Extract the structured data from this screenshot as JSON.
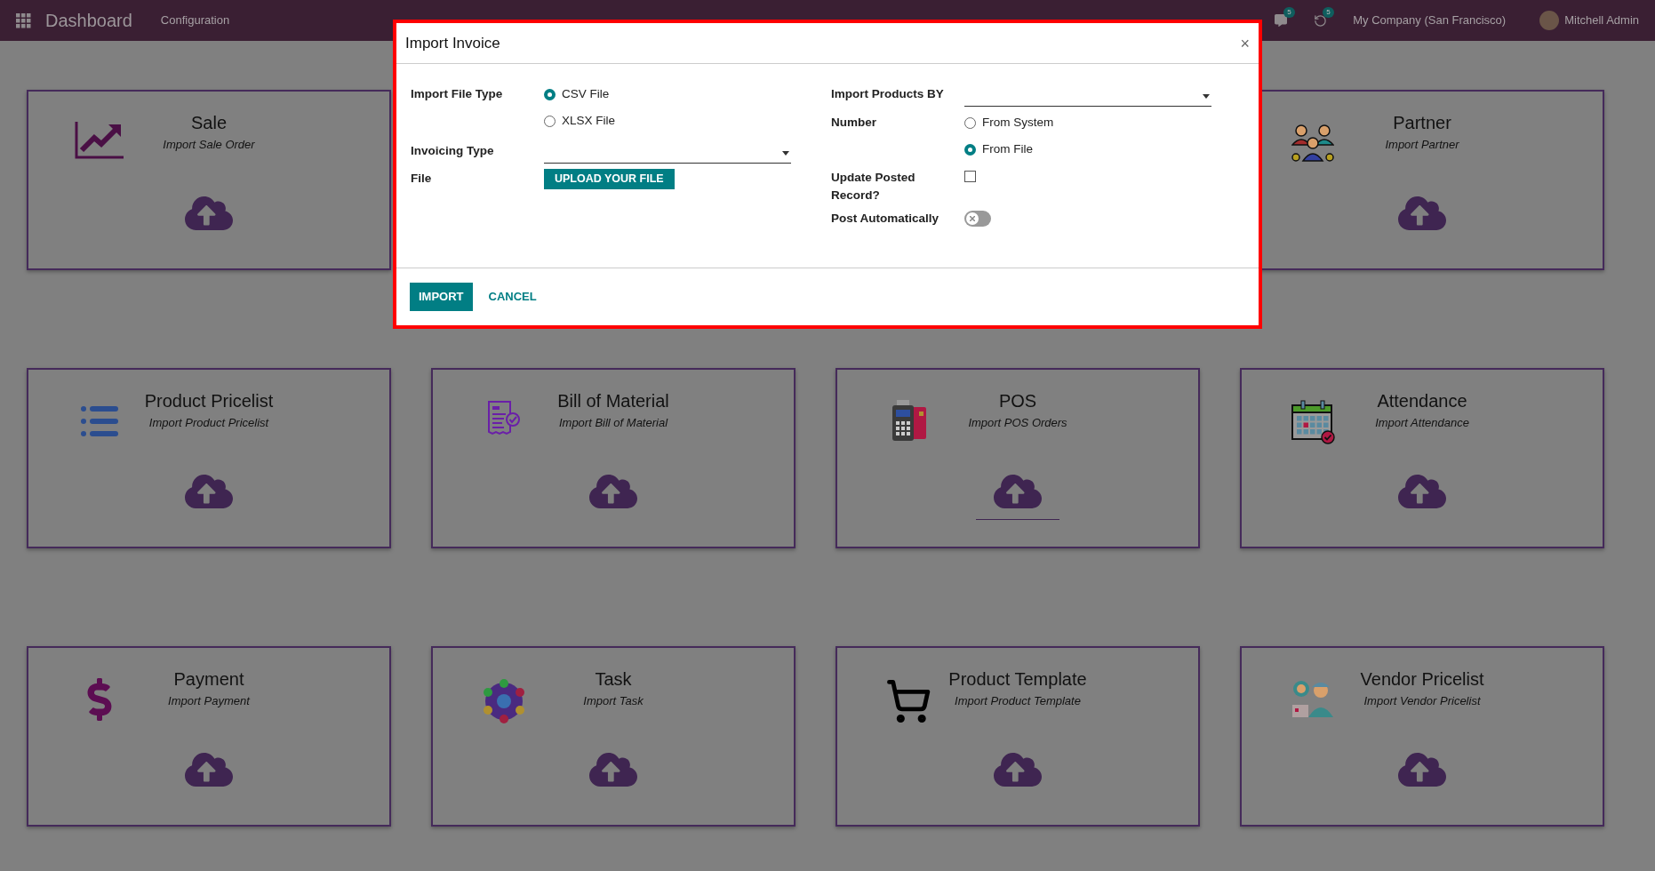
{
  "navbar": {
    "app_title": "Dashboard",
    "menu": [
      {
        "label": "Configuration"
      }
    ],
    "messages_badge": "5",
    "activities_badge": "5",
    "company": "My Company (San Francisco)",
    "user": "Mitchell Admin"
  },
  "cards": [
    {
      "title": "Sale",
      "subtitle": "Import Sale Order",
      "focused": false
    },
    {
      "title": "Partner",
      "subtitle": "Import Partner",
      "focused": false
    },
    {
      "title": "Product Pricelist",
      "subtitle": "Import Product Pricelist",
      "focused": false
    },
    {
      "title": "Bill of Material",
      "subtitle": "Import Bill of Material",
      "focused": false
    },
    {
      "title": "POS",
      "subtitle": "Import POS Orders",
      "focused": true
    },
    {
      "title": "Attendance",
      "subtitle": "Import Attendance",
      "focused": false
    },
    {
      "title": "Payment",
      "subtitle": "Import Payment",
      "focused": false
    },
    {
      "title": "Task",
      "subtitle": "Import Task",
      "focused": false
    },
    {
      "title": "Product Template",
      "subtitle": "Import Product Template",
      "focused": false
    },
    {
      "title": "Vendor Pricelist",
      "subtitle": "Import Vendor Pricelist",
      "focused": false
    }
  ],
  "dialog": {
    "title": "Import Invoice",
    "close": "×",
    "import_file_type": {
      "label": "Import File Type",
      "options": [
        {
          "label": "CSV File",
          "selected": true
        },
        {
          "label": "XLSX File",
          "selected": false
        }
      ]
    },
    "invoicing_type": {
      "label": "Invoicing Type"
    },
    "file": {
      "label": "File",
      "button": "UPLOAD YOUR FILE"
    },
    "import_products_by": {
      "label": "Import Products BY"
    },
    "number": {
      "label": "Number",
      "options": [
        {
          "label": "From System",
          "selected": false
        },
        {
          "label": "From File",
          "selected": true
        }
      ]
    },
    "update_posted_record": {
      "label": "Update Posted Record?",
      "checked": false
    },
    "post_automatically": {
      "label": "Post Automatically",
      "on": false
    },
    "buttons": [
      {
        "label": "IMPORT",
        "kind": "primary"
      },
      {
        "label": "CANCEL",
        "kind": "link"
      }
    ]
  }
}
